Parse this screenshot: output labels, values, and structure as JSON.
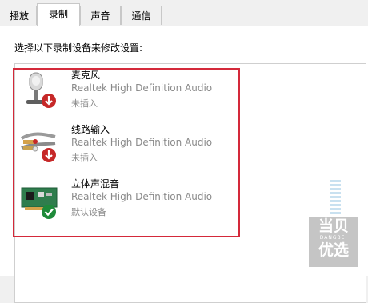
{
  "tabs": [
    "播放",
    "录制",
    "声音",
    "通信"
  ],
  "active_tab": "录制",
  "instruction": "选择以下录制设备来修改设置:",
  "devices": [
    {
      "name": "麦克风",
      "driver": "Realtek High Definition Audio",
      "status": "未插入",
      "icon": "microphone-icon",
      "badge": "unplugged-badge-icon"
    },
    {
      "name": "线路输入",
      "driver": "Realtek High Definition Audio",
      "status": "未插入",
      "icon": "line-in-cable-icon",
      "badge": "unplugged-badge-icon"
    },
    {
      "name": "立体声混音",
      "driver": "Realtek High Definition Audio",
      "status": "默认设备",
      "icon": "sound-card-icon",
      "badge": "default-check-icon"
    }
  ],
  "watermark": {
    "line1": "当贝",
    "sub": "DANGBEI",
    "line2": "优选"
  },
  "colors": {
    "highlight": "#d4293a",
    "badge_red": "#c62828",
    "badge_green": "#1e8a3a"
  }
}
